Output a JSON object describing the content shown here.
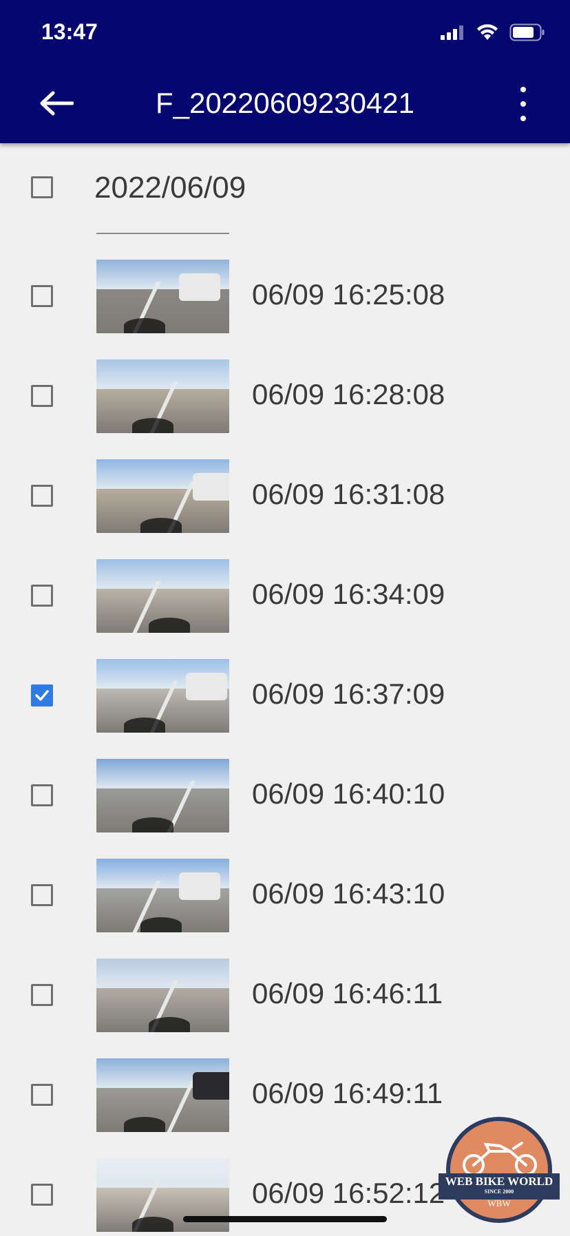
{
  "status_bar": {
    "time": "13:47"
  },
  "header": {
    "title": "F_20220609230421",
    "back_icon": "arrow-left-icon",
    "menu_icon": "more-vert-icon"
  },
  "colors": {
    "header_bg": "#04056e",
    "checkbox_checked": "#2f7be0",
    "background": "#f0f0f0"
  },
  "group": {
    "date": "2022/06/09",
    "checked": false
  },
  "recordings": [
    {
      "time": "06/09 16:25:08",
      "checked": false
    },
    {
      "time": "06/09 16:28:08",
      "checked": false
    },
    {
      "time": "06/09 16:31:08",
      "checked": false
    },
    {
      "time": "06/09 16:34:09",
      "checked": false
    },
    {
      "time": "06/09 16:37:09",
      "checked": true
    },
    {
      "time": "06/09 16:40:10",
      "checked": false
    },
    {
      "time": "06/09 16:43:10",
      "checked": false
    },
    {
      "time": "06/09 16:46:11",
      "checked": false
    },
    {
      "time": "06/09 16:49:11",
      "checked": false
    },
    {
      "time": "06/09 16:52:12",
      "checked": false
    }
  ],
  "watermark": {
    "text": "WEB BIKE WORLD",
    "subtext": "SINCE 2000",
    "initials": "WBW"
  }
}
